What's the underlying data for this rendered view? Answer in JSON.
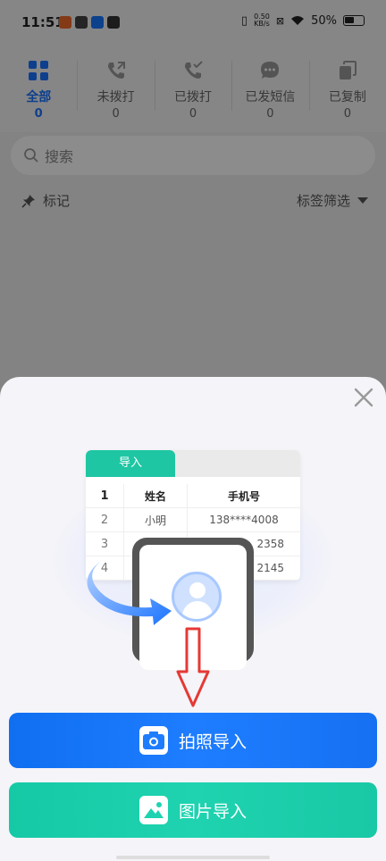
{
  "status_bar": {
    "time": "11:51",
    "netspeed_value": "0.50",
    "netspeed_unit": "KB/s",
    "battery": "50%"
  },
  "tabs": [
    {
      "label": "全部",
      "count": "0",
      "active": true
    },
    {
      "label": "未拨打",
      "count": "0"
    },
    {
      "label": "已拨打",
      "count": "0"
    },
    {
      "label": "已发短信",
      "count": "0"
    },
    {
      "label": "已复制",
      "count": "0"
    }
  ],
  "search": {
    "placeholder": "搜索"
  },
  "filters": {
    "mark_label": "标记",
    "tag_filter_label": "标签筛选"
  },
  "sheet": {
    "illustration": {
      "tab_label": "导入",
      "table_headers": [
        "姓名",
        "手机号"
      ],
      "rows": [
        {
          "index": "1",
          "name": "",
          "phone": ""
        },
        {
          "index": "2",
          "name": "小明",
          "phone": "138****4008"
        },
        {
          "index": "3",
          "name": "",
          "phone": "2358"
        },
        {
          "index": "4",
          "name": "",
          "phone": "2145"
        }
      ]
    },
    "buttons": {
      "photo_import": "拍照导入",
      "image_import": "图片导入"
    }
  },
  "colors": {
    "accent_blue": "#1a73ff",
    "photo_button": "#1e7dff",
    "image_button": "#1fd3b0",
    "arrow_red": "#e53935"
  }
}
